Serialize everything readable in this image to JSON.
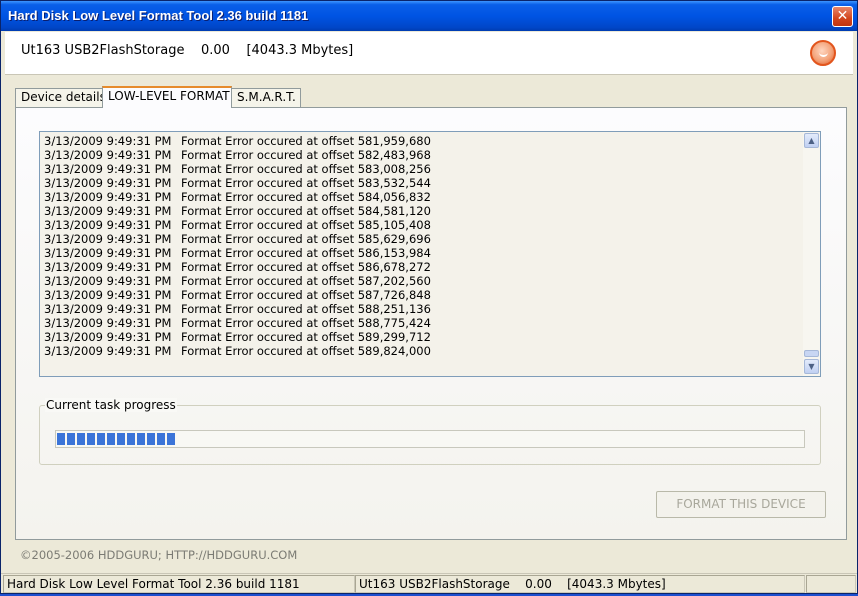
{
  "window": {
    "title": "Hard Disk Low Level Format Tool 2.36 build 1181",
    "close_glyph": "✕"
  },
  "header": {
    "device_text": "Ut163 USB2FlashStorage    0.00    [4043.3 Mbytes]",
    "logo_icon": "hddguru-logo-icon"
  },
  "tabs": [
    {
      "label": "Device details",
      "active": false
    },
    {
      "label": "LOW-LEVEL FORMAT",
      "active": true
    },
    {
      "label": "S.M.A.R.T.",
      "active": false
    }
  ],
  "log": {
    "lines": [
      {
        "time": "3/13/2009 9:49:31 PM",
        "message": "Format Error occured at offset 581,959,680"
      },
      {
        "time": "3/13/2009 9:49:31 PM",
        "message": "Format Error occured at offset 582,483,968"
      },
      {
        "time": "3/13/2009 9:49:31 PM",
        "message": "Format Error occured at offset 583,008,256"
      },
      {
        "time": "3/13/2009 9:49:31 PM",
        "message": "Format Error occured at offset 583,532,544"
      },
      {
        "time": "3/13/2009 9:49:31 PM",
        "message": "Format Error occured at offset 584,056,832"
      },
      {
        "time": "3/13/2009 9:49:31 PM",
        "message": "Format Error occured at offset 584,581,120"
      },
      {
        "time": "3/13/2009 9:49:31 PM",
        "message": "Format Error occured at offset 585,105,408"
      },
      {
        "time": "3/13/2009 9:49:31 PM",
        "message": "Format Error occured at offset 585,629,696"
      },
      {
        "time": "3/13/2009 9:49:31 PM",
        "message": "Format Error occured at offset 586,153,984"
      },
      {
        "time": "3/13/2009 9:49:31 PM",
        "message": "Format Error occured at offset 586,678,272"
      },
      {
        "time": "3/13/2009 9:49:31 PM",
        "message": "Format Error occured at offset 587,202,560"
      },
      {
        "time": "3/13/2009 9:49:31 PM",
        "message": "Format Error occured at offset 587,726,848"
      },
      {
        "time": "3/13/2009 9:49:31 PM",
        "message": "Format Error occured at offset 588,251,136"
      },
      {
        "time": "3/13/2009 9:49:31 PM",
        "message": "Format Error occured at offset 588,775,424"
      },
      {
        "time": "3/13/2009 9:49:31 PM",
        "message": "Format Error occured at offset 589,299,712"
      },
      {
        "time": "3/13/2009 9:49:31 PM",
        "message": "Format Error occured at offset 589,824,000"
      }
    ],
    "scroll_up_glyph": "▲",
    "scroll_down_glyph": "▼"
  },
  "progress": {
    "legend": "Current task progress",
    "fraction": 0.16,
    "color": "#3b74d8"
  },
  "format_button": {
    "label": "FORMAT THIS DEVICE",
    "enabled": false
  },
  "footer": {
    "copyright": "©2005-2006 HDDGURU;  HTTP://HDDGURU.COM"
  },
  "statusbar": {
    "app": "Hard Disk Low Level Format Tool 2.36 build 1181",
    "device": "Ut163 USB2FlashStorage    0.00    [4043.3 Mbytes]",
    "extra": ""
  }
}
